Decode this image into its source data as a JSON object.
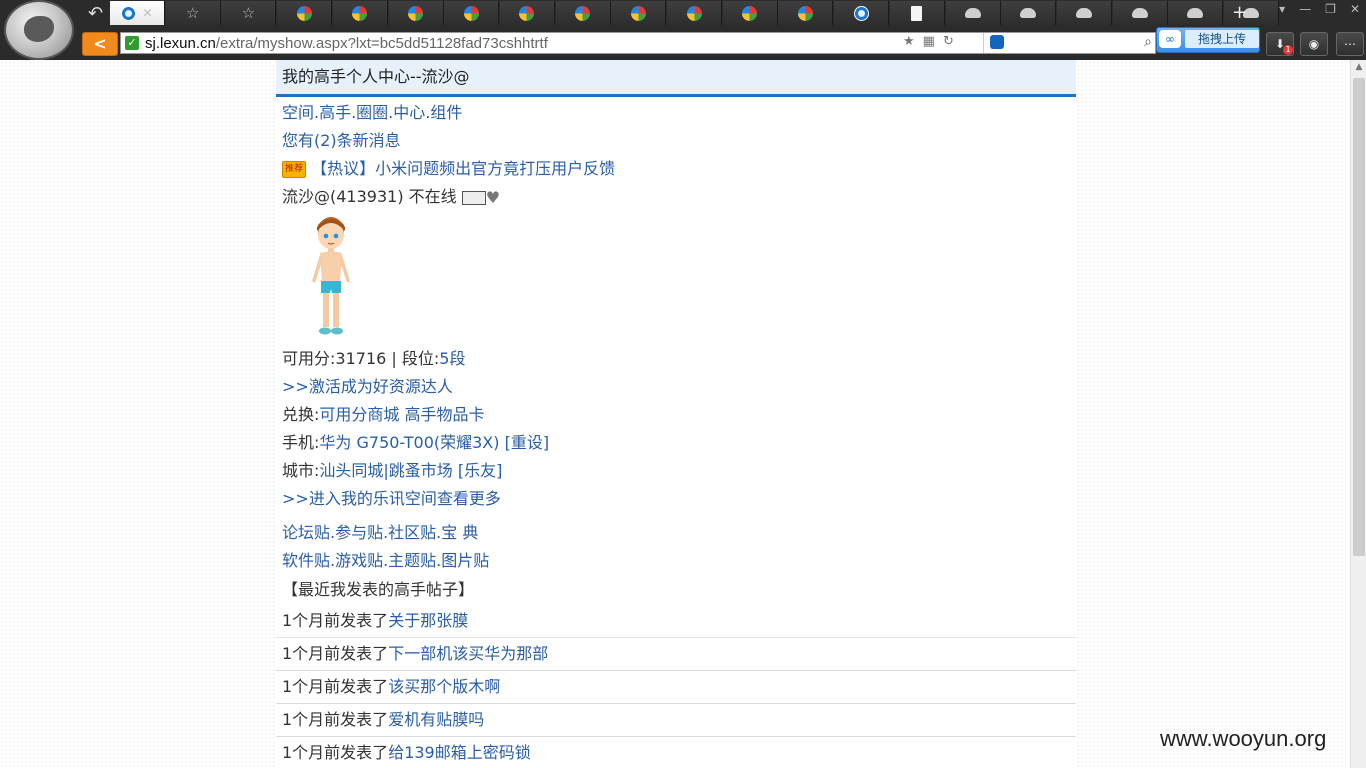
{
  "browser": {
    "tabs": [
      {
        "icon": "ie-icon",
        "active": true
      },
      {
        "icon": "star-icon"
      },
      {
        "icon": "star-icon"
      },
      {
        "icon": "sina-icon"
      },
      {
        "icon": "sina-icon"
      },
      {
        "icon": "sina-icon"
      },
      {
        "icon": "sina-icon"
      },
      {
        "icon": "sina-icon"
      },
      {
        "icon": "sina-icon"
      },
      {
        "icon": "sina-icon"
      },
      {
        "icon": "sina-icon"
      },
      {
        "icon": "sina-icon"
      },
      {
        "icon": "sina-icon"
      },
      {
        "icon": "ie-icon"
      },
      {
        "icon": "doc-icon"
      },
      {
        "icon": "cloud-icon"
      },
      {
        "icon": "cloud-icon"
      },
      {
        "icon": "cloud-icon"
      },
      {
        "icon": "cloud-icon"
      },
      {
        "icon": "cloud-icon"
      },
      {
        "icon": "cloud-icon"
      }
    ],
    "url_host": "sj.lexun.cn",
    "url_path": "/extra/myshow.aspx?lxt=bc5dd51128fad73cshhtrtf",
    "upload_button": "拖拽上传",
    "download_badge": "1"
  },
  "page": {
    "header_title": "我的高手个人中心--流沙@",
    "nav_links": "空间.高手.圈圈.中心.组件",
    "messages": "您有(2)条新消息",
    "hot_tag": "推荐",
    "hot_news": "【热议】小米问题频出官方竟打压用户反馈",
    "user_line": "流沙@(413931) 不在线",
    "points_label": "可用分:",
    "points_value": "31716",
    "rank_label": "段位:",
    "rank_value": "5段",
    "activate": ">>激活成为好资源达人",
    "exchange_label": "兑换:",
    "exchange_links": "可用分商城 高手物品卡",
    "phone_label": "手机:",
    "phone_value": "华为 G750-T00(荣耀3X)",
    "phone_reset": "[重设]",
    "city_label": "城市:",
    "city_value": "汕头同城|跳蚤市场",
    "city_friends": "[乐友]",
    "more_link": ">>进入我的乐讯空间查看更多",
    "posts_links_1": "论坛贴.参与贴.社区贴.宝 典",
    "posts_links_2": "软件贴.游戏贴.主题贴.图片贴",
    "recent_title": "【最近我发表的高手帖子】",
    "recent_posts": [
      {
        "time": "1个月前发表了",
        "title": "关于那张膜"
      },
      {
        "time": "1个月前发表了",
        "title": "下一部机该买华为那部"
      },
      {
        "time": "1个月前发表了",
        "title": "该买那个版木啊"
      },
      {
        "time": "1个月前发表了",
        "title": "爱机有贴膜吗"
      },
      {
        "time": "1个月前发表了",
        "title": "给139邮箱上密码锁"
      }
    ]
  },
  "watermark": "www.wooyun.org",
  "colors": {
    "link": "#2a5ea8",
    "header_bg": "#e6f1fc",
    "header_border": "#1a73c8",
    "address_back": "#f08a1c"
  }
}
